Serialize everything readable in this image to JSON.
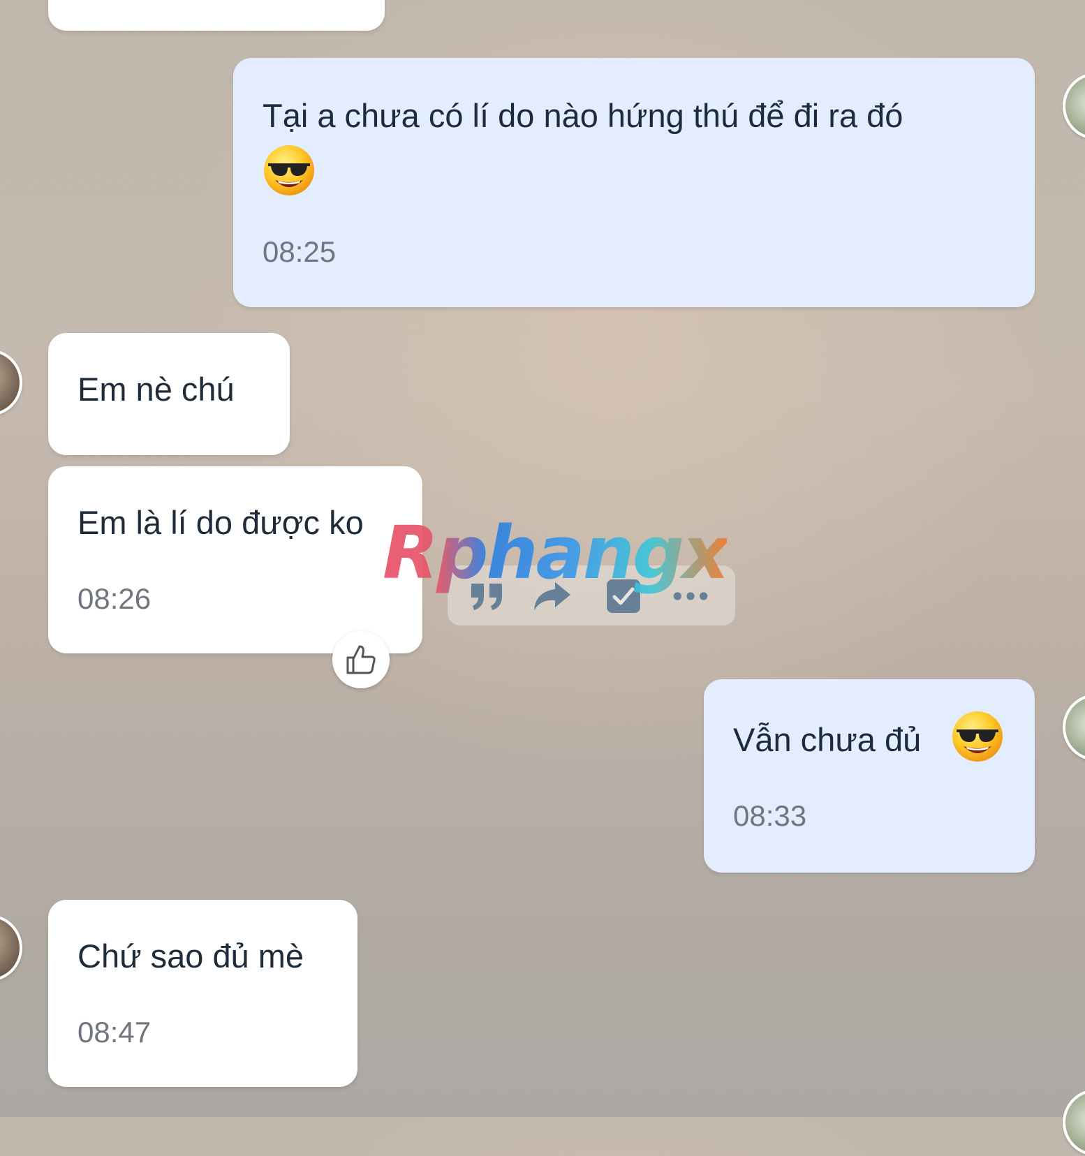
{
  "messages": [
    {
      "id": "m0",
      "direction": "incoming",
      "text": "",
      "time": ""
    },
    {
      "id": "m1",
      "direction": "outgoing",
      "text": "Tại a chưa có lí do nào hứng thú để đi ra đó",
      "emoji": "sunglasses-face",
      "time": "08:25"
    },
    {
      "id": "m2",
      "direction": "incoming",
      "text": "Em nè chú",
      "time": ""
    },
    {
      "id": "m3",
      "direction": "incoming",
      "text": "Em là lí do được ko",
      "time": "08:26",
      "reaction": "thumbs-up"
    },
    {
      "id": "m4",
      "direction": "outgoing",
      "text": "Vẫn chưa đủ",
      "emoji": "sunglasses-face",
      "time": "08:33"
    },
    {
      "id": "m5",
      "direction": "incoming",
      "text": "Chứ sao đủ mè",
      "time": "08:47"
    }
  ],
  "message_toolbar": {
    "actions": [
      "quote-icon",
      "forward-icon",
      "select-icon",
      "more-icon"
    ]
  },
  "watermark": {
    "text": "Rphangx"
  },
  "colors": {
    "incoming_bubble": "#ffffff",
    "outgoing_bubble": "#e3edfd",
    "message_text": "#1e2b3a",
    "timestamp": "#707580"
  }
}
